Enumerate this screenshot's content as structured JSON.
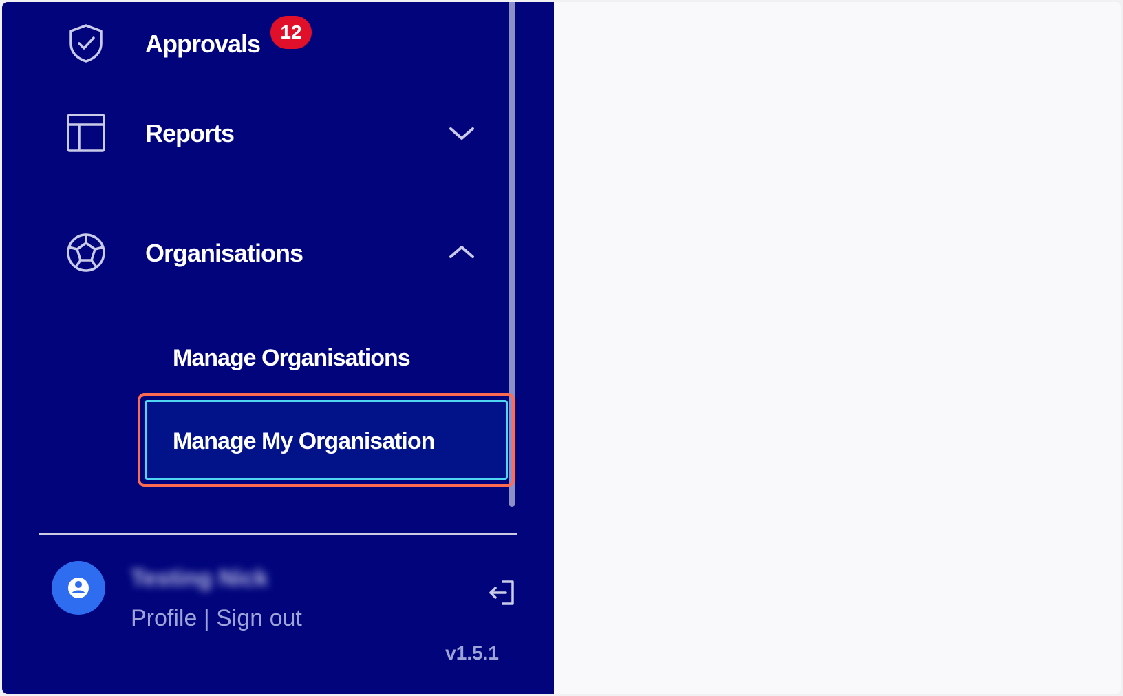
{
  "sidebar": {
    "items": [
      {
        "label": "Approvals",
        "icon": "shield-check-icon",
        "badge": "12"
      },
      {
        "label": "Reports",
        "icon": "table-layout-icon",
        "chevron": "chevron-down-icon"
      },
      {
        "label": "Organisations",
        "icon": "organisation-network-icon",
        "chevron": "chevron-up-icon"
      }
    ],
    "sub_items": [
      {
        "label": "Manage Organisations"
      },
      {
        "label": "Manage My Organisation",
        "selected": true
      }
    ]
  },
  "user": {
    "name": "Testing Nick",
    "profile_link": "Profile",
    "separator": "|",
    "signout_link": "Sign out"
  },
  "version": "v1.5.1",
  "colors": {
    "sidebar_bg": "#01047b",
    "badge": "#e0102b",
    "highlight_outline": "#ff6a52",
    "focus_ring": "#4fd6f2",
    "avatar": "#2f6df0"
  }
}
